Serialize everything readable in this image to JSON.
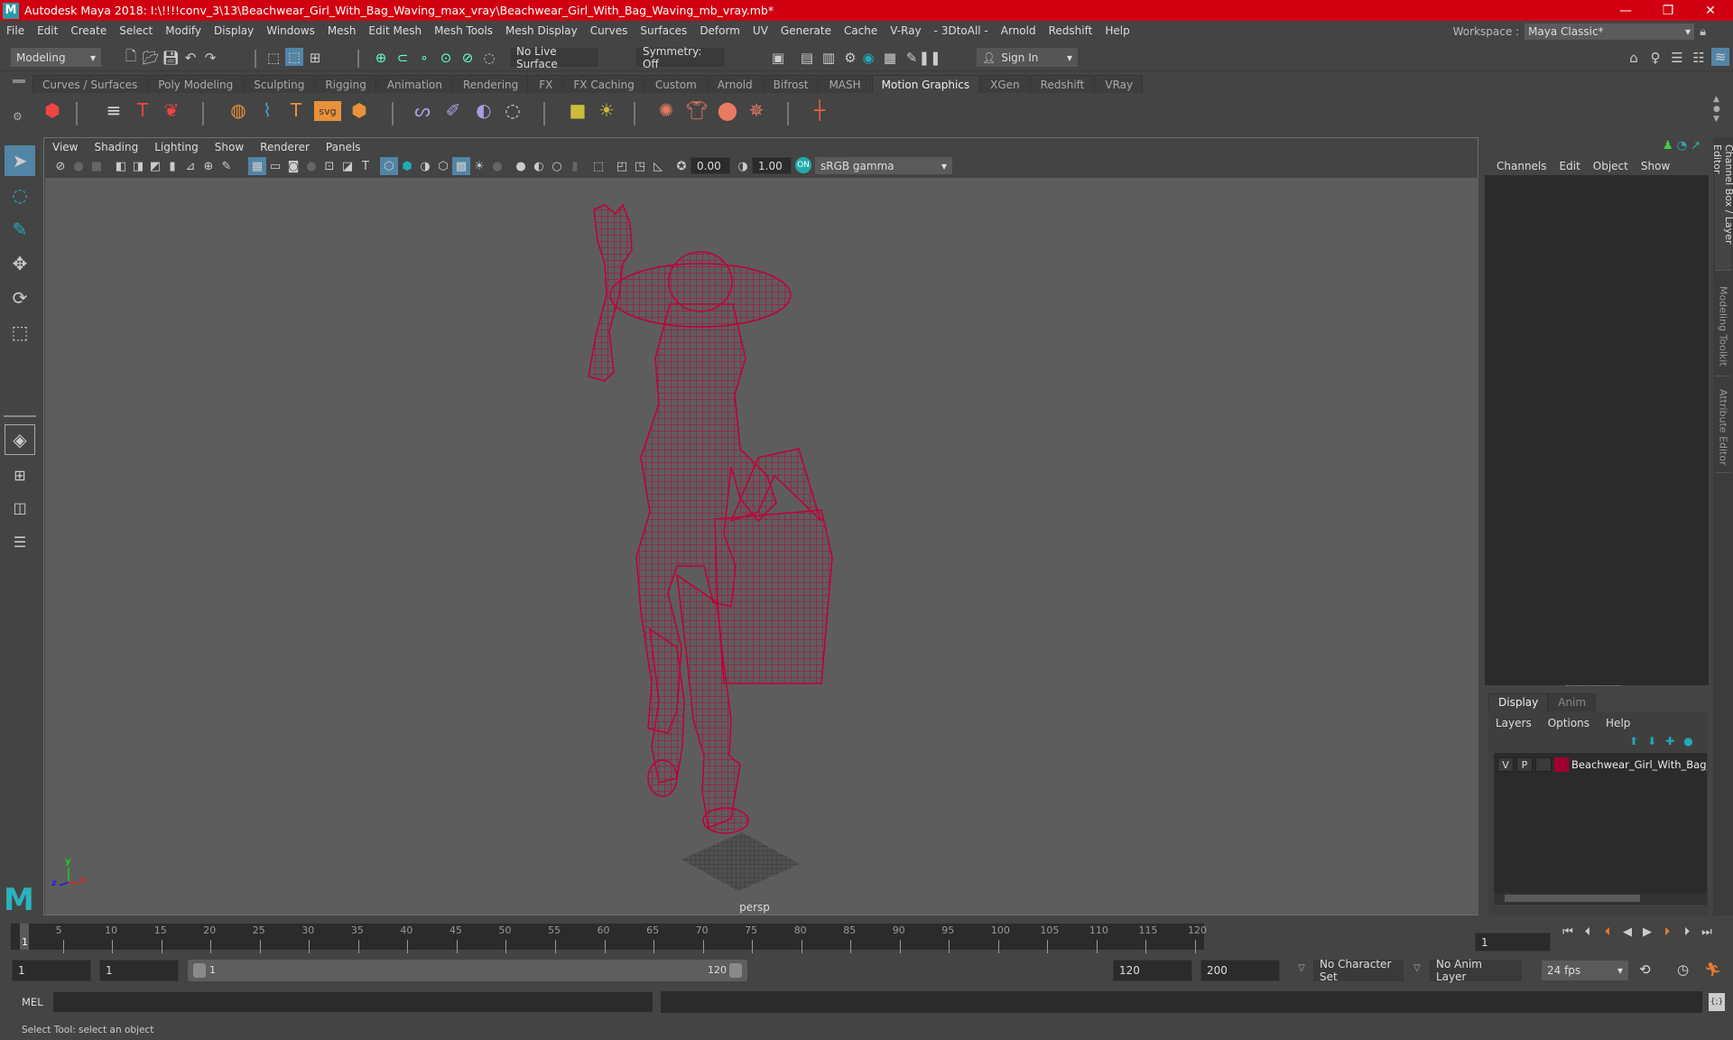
{
  "window": {
    "title": "Autodesk Maya 2018: I:\\!!!!conv_3\\13\\Beachwear_Girl_With_Bag_Waving_max_vray\\Beachwear_Girl_With_Bag_Waving_mb_vray.mb*",
    "logo": "M",
    "minimize": "—",
    "restore": "❐",
    "close": "✕"
  },
  "menubar": [
    "File",
    "Edit",
    "Create",
    "Select",
    "Modify",
    "Display",
    "Windows",
    "Mesh",
    "Edit Mesh",
    "Mesh Tools",
    "Mesh Display",
    "Curves",
    "Surfaces",
    "Deform",
    "UV",
    "Generate",
    "Cache",
    "V-Ray",
    "- 3DtoAll -",
    "Arnold",
    "Redshift",
    "Help"
  ],
  "workspace": {
    "label": "Workspace :",
    "value": "Maya Classic*"
  },
  "statusline": {
    "mode": "Modeling",
    "live_surface": "No Live Surface",
    "symmetry": "Symmetry: Off",
    "sign_in": "Sign In"
  },
  "shelf": {
    "tabs": [
      "Curves / Surfaces",
      "Poly Modeling",
      "Sculpting",
      "Rigging",
      "Animation",
      "Rendering",
      "FX",
      "FX Caching",
      "Custom",
      "Arnold",
      "Bifrost",
      "MASH",
      "Motion Graphics",
      "XGen",
      "Redshift",
      "VRay"
    ],
    "active_tab": "Motion Graphics"
  },
  "viewport": {
    "menu": [
      "View",
      "Shading",
      "Lighting",
      "Show",
      "Renderer",
      "Panels"
    ],
    "exposure": "0.00",
    "gamma": "1.00",
    "color_space": "sRGB gamma",
    "camera_label": "persp",
    "axis": {
      "x": "x",
      "y": "y",
      "z": "z"
    },
    "mesh_color": "#c0003a"
  },
  "channel_box": {
    "menu": [
      "Channels",
      "Edit",
      "Object",
      "Show"
    ]
  },
  "layer_editor": {
    "tabs": [
      "Display",
      "Anim"
    ],
    "active_tab": "Display",
    "menu": [
      "Layers",
      "Options",
      "Help"
    ],
    "layers": [
      {
        "v": "V",
        "p": "P",
        "color": "#a00030",
        "name": "Beachwear_Girl_With_Bag_Waving"
      }
    ]
  },
  "side_tabs": [
    "Channel Box / Layer Editor",
    "Modeling Toolkit",
    "Attribute Editor"
  ],
  "timeline": {
    "ticks": [
      5,
      10,
      15,
      20,
      25,
      30,
      35,
      40,
      45,
      50,
      55,
      60,
      65,
      70,
      75,
      80,
      85,
      90,
      95,
      100,
      105,
      110,
      115,
      120
    ],
    "current_frame": "1",
    "current_frame_field": "1",
    "start": 1,
    "end": 120
  },
  "range": {
    "start_time": "1",
    "playback_start": "1",
    "slider_start": "1",
    "slider_end": "120",
    "playback_end": "120",
    "end_time": "200",
    "character_set": "No Character Set",
    "anim_layer": "No Anim Layer",
    "fps": "24 fps"
  },
  "cmdline": {
    "label": "MEL",
    "value": ""
  },
  "helpline": "Select Tool: select an object"
}
